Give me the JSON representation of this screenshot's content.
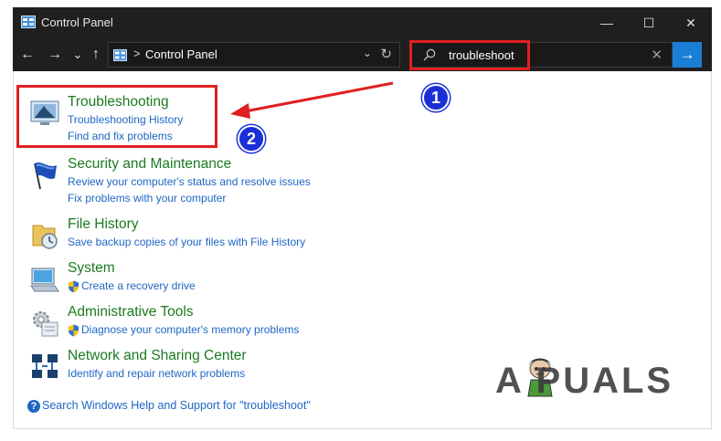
{
  "window": {
    "title": "Control Panel",
    "controls": {
      "minimize": "—",
      "maximize": "☐",
      "close": "✕"
    }
  },
  "nav": {
    "back": "←",
    "forward": "→",
    "recent": "⌄",
    "up": "↑"
  },
  "address": {
    "separator": ">",
    "breadcrumb": "Control Panel",
    "dropdown": "⌄",
    "refresh": "↻"
  },
  "search": {
    "value": "troubleshoot",
    "clear": "✕",
    "go": "→"
  },
  "results": [
    {
      "icon": "troubleshooting-icon",
      "heading": "Troubleshooting",
      "links": [
        {
          "text": "Troubleshooting History",
          "shield": false
        },
        {
          "text": "Find and fix problems",
          "shield": false
        }
      ]
    },
    {
      "icon": "security-flag-icon",
      "heading": "Security and Maintenance",
      "links": [
        {
          "text": "Review your computer's status and resolve issues",
          "shield": false
        },
        {
          "text": "Fix problems with your computer",
          "shield": false
        }
      ]
    },
    {
      "icon": "file-history-icon",
      "heading": "File History",
      "links": [
        {
          "text": "Save backup copies of your files with File History",
          "shield": false
        }
      ]
    },
    {
      "icon": "system-icon",
      "heading": "System",
      "links": [
        {
          "text": "Create a recovery drive",
          "shield": true
        }
      ]
    },
    {
      "icon": "administrative-tools-icon",
      "heading": "Administrative Tools",
      "links": [
        {
          "text": "Diagnose your computer's memory problems",
          "shield": true
        }
      ]
    },
    {
      "icon": "network-icon",
      "heading": "Network and Sharing Center",
      "links": [
        {
          "text": "Identify and repair network problems",
          "shield": false
        }
      ]
    }
  ],
  "footer": {
    "help_glyph": "?",
    "text": "Search Windows Help and Support for \"troubleshoot\""
  },
  "annotations": {
    "badge_1": "1",
    "badge_2": "2",
    "color": "#e02020",
    "badge_color": "#1a2fd8"
  },
  "watermark": "A PUALS",
  "colors": {
    "chrome": "#1f1f1f",
    "heading_green": "#1b7b1f",
    "link_blue": "#1e66c4",
    "accent": "#1a7fd4"
  }
}
